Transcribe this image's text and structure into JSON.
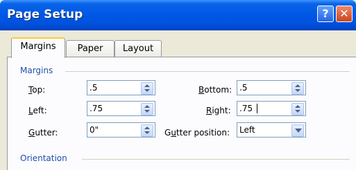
{
  "window": {
    "title": "Page Setup"
  },
  "titlebar_buttons": {
    "help": "?",
    "close": "✕"
  },
  "tabs": [
    {
      "label": "Margins",
      "active": true
    },
    {
      "label": "Paper",
      "active": false
    },
    {
      "label": "Layout",
      "active": false
    }
  ],
  "margins_section": {
    "heading": "Margins",
    "top": {
      "label_prefix": "",
      "accel": "T",
      "label_rest": "op:",
      "value": ".5"
    },
    "left": {
      "label_prefix": "",
      "accel": "L",
      "label_rest": "eft:",
      "value": ".75"
    },
    "gutter": {
      "label_prefix": "",
      "accel": "G",
      "label_rest": "utter:",
      "value": "0\""
    },
    "bottom": {
      "label_prefix": "",
      "accel": "B",
      "label_rest": "ottom:",
      "value": ".5"
    },
    "right": {
      "label_prefix": "",
      "accel": "R",
      "label_rest": "ight:",
      "value": ".75"
    },
    "gutter_position": {
      "label_prefix": "G",
      "accel": "u",
      "label_rest": "tter position:",
      "value": "Left"
    }
  },
  "orientation_section": {
    "heading": "Orientation"
  },
  "icons": {
    "spin_up": "triangle-up",
    "spin_down": "triangle-down",
    "dropdown": "chevron-down"
  },
  "colors": {
    "title_bar": "#0058e6",
    "section_heading": "#1f4ea8",
    "active_tab_accent": "#ffc83c"
  }
}
